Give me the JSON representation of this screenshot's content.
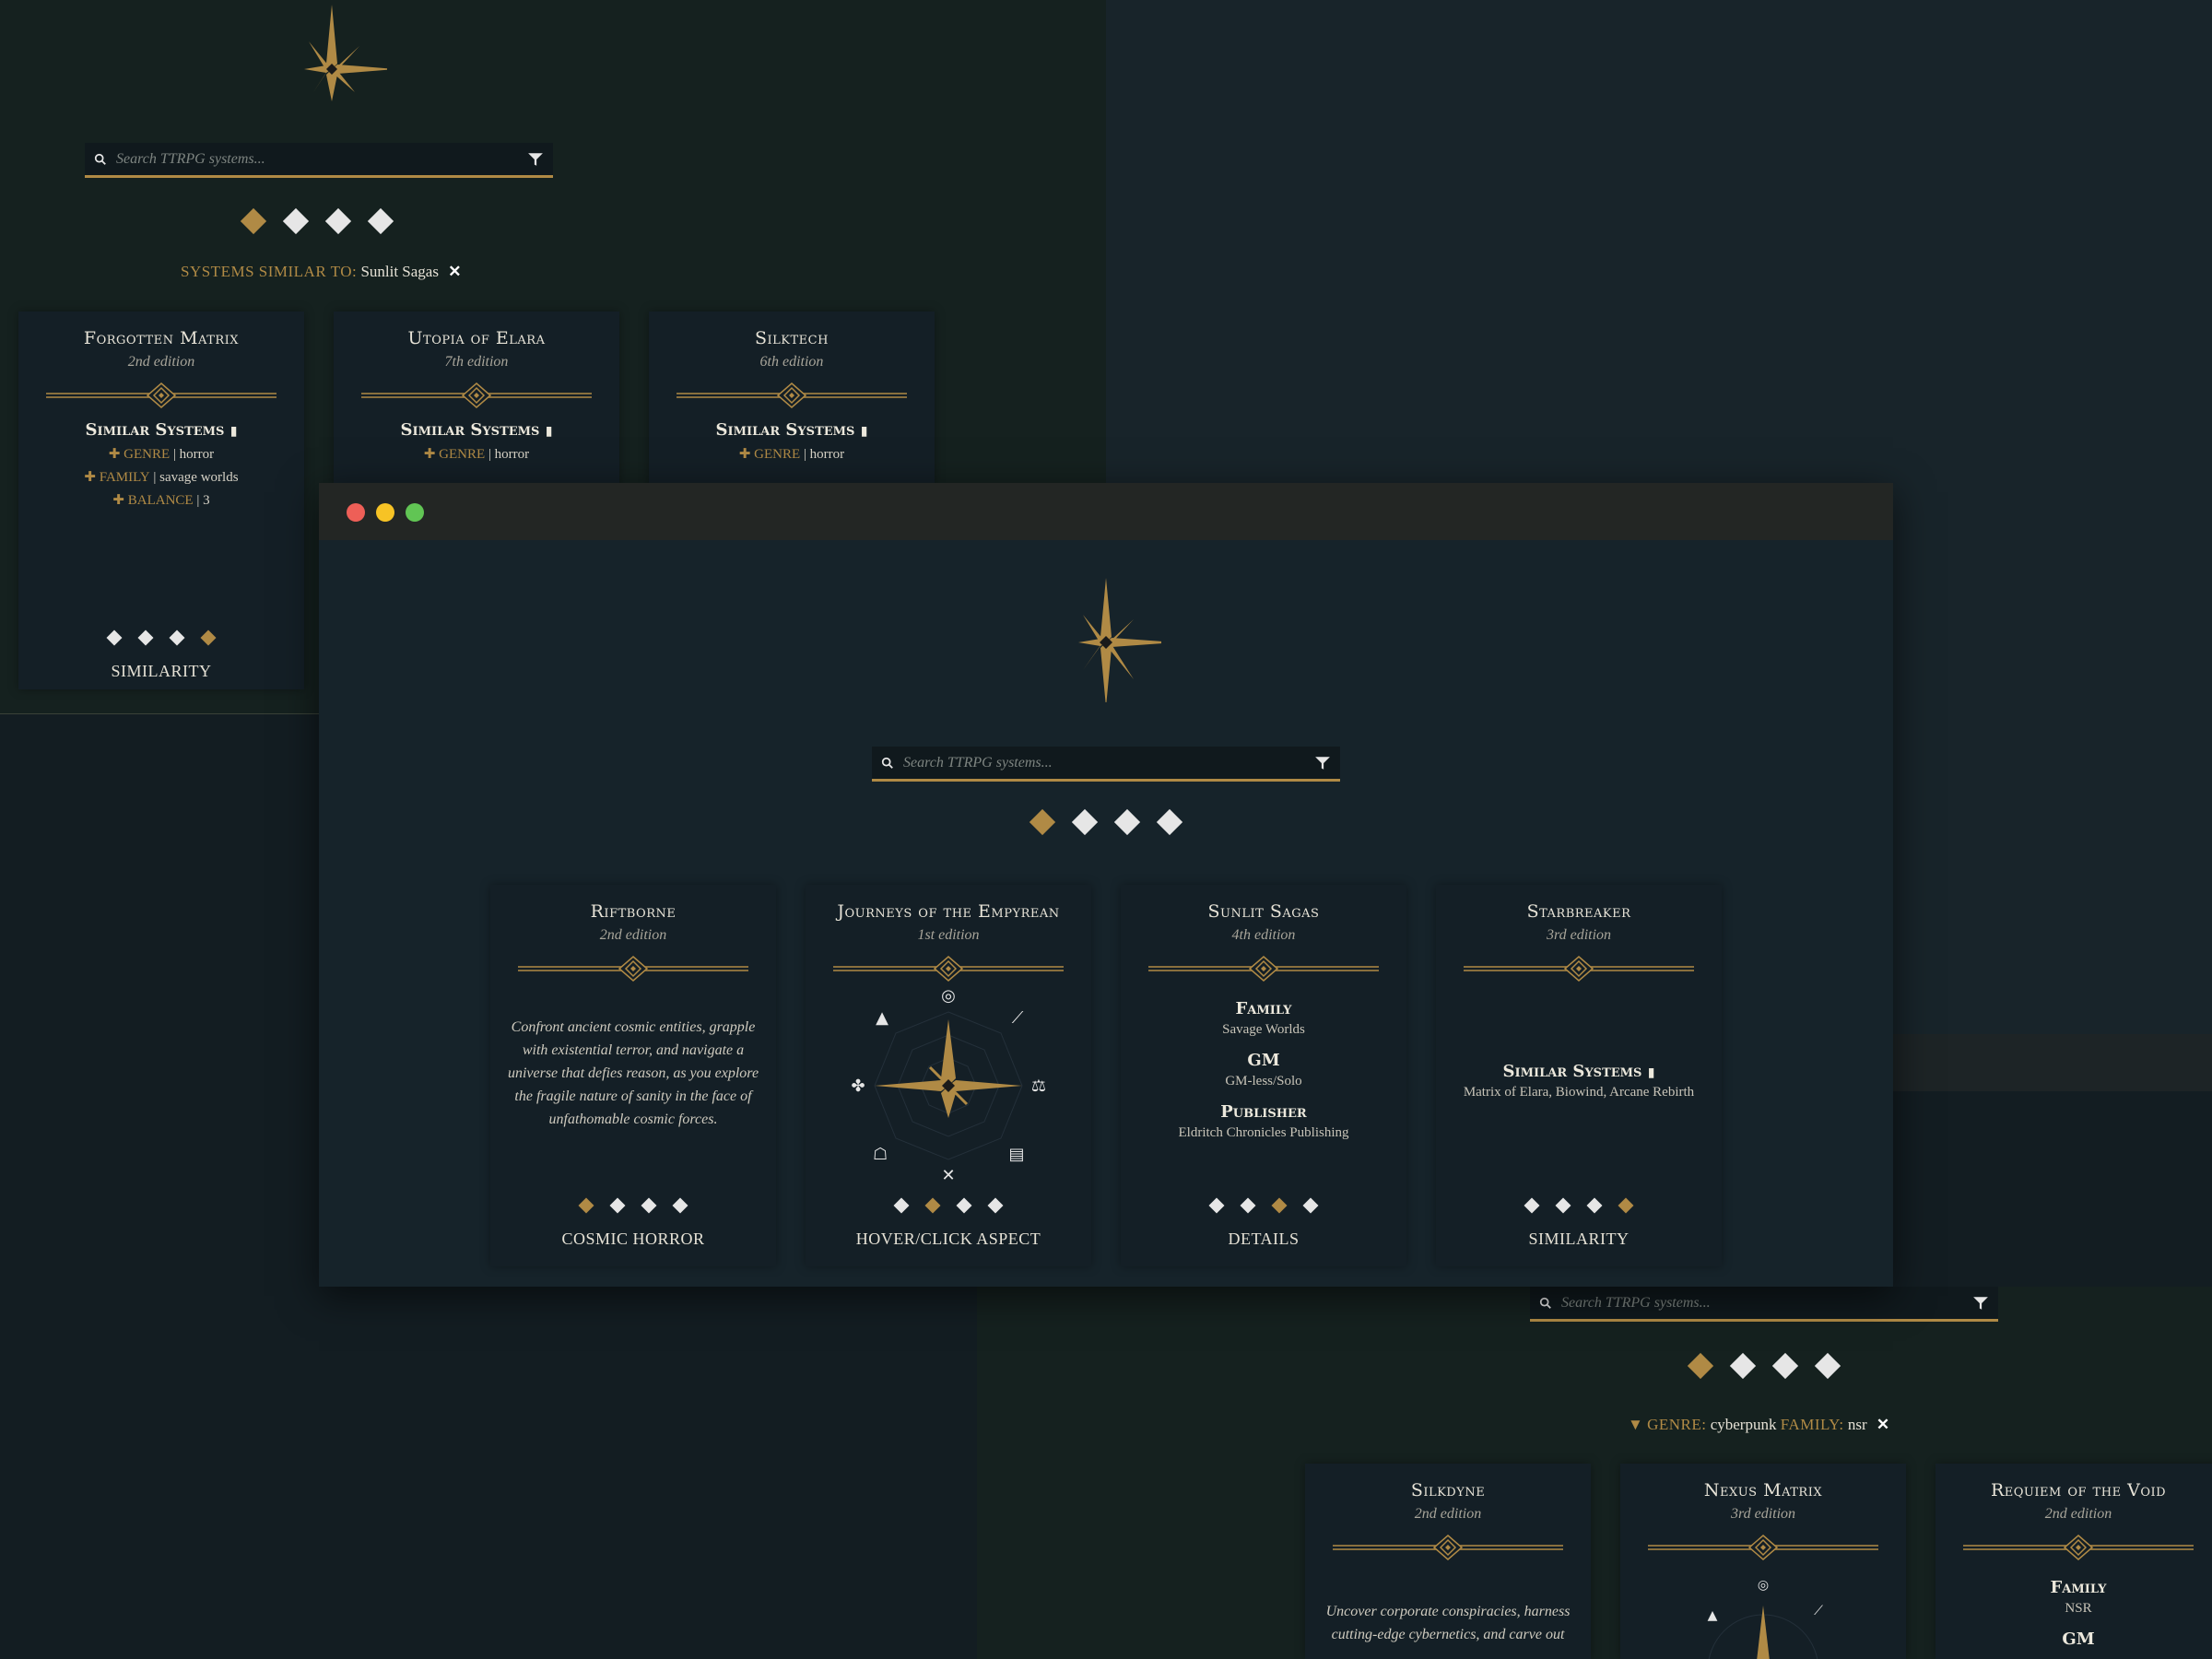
{
  "search": {
    "placeholder": "Search TTRPG systems..."
  },
  "top_panel": {
    "similar_label": "SYSTEMS SIMILAR TO:",
    "similar_value": "Sunlit Sagas",
    "cards": [
      {
        "title": "Forgotten Matrix",
        "edition": "2nd edition",
        "section": "Similar Systems",
        "rows": [
          {
            "k": "GENRE",
            "v": "horror"
          },
          {
            "k": "FAMILY",
            "v": "savage worlds"
          },
          {
            "k": "BALANCE",
            "v": "3"
          }
        ],
        "footer": "SIMILARITY"
      },
      {
        "title": "Utopia of Elara",
        "edition": "7th edition",
        "section": "Similar Systems",
        "rows": [
          {
            "k": "GENRE",
            "v": "horror"
          }
        ]
      },
      {
        "title": "Silktech",
        "edition": "6th edition",
        "section": "Similar Systems",
        "rows": [
          {
            "k": "GENRE",
            "v": "horror"
          }
        ]
      }
    ]
  },
  "main_window": {
    "cards": [
      {
        "title": "Riftborne",
        "edition": "2nd edition",
        "description": "Confront ancient cosmic entities, grapple with existential terror, and navigate a universe that defies reason, as you explore the fragile nature of sanity in the face of unfathomable cosmic forces.",
        "footer": "COSMIC HORROR",
        "active_dot": 0
      },
      {
        "title": "Journeys of the Empyrean",
        "edition": "1st edition",
        "footer": "HOVER/CLICK ASPECT",
        "active_dot": 1,
        "aspect_icons": [
          "brain-icon",
          "stairs-icon",
          "scales-icon",
          "scroll-icon",
          "swords-icon",
          "wizard-icon",
          "puzzle-icon",
          "shapes-icon"
        ]
      },
      {
        "title": "Sunlit Sagas",
        "edition": "4th edition",
        "details": [
          {
            "label": "Family",
            "value": "Savage Worlds"
          },
          {
            "label": "GM",
            "value": "GM-less/Solo"
          },
          {
            "label": "Publisher",
            "value": "Eldritch Chronicles Publishing"
          }
        ],
        "footer": "DETAILS",
        "active_dot": 2
      },
      {
        "title": "Starbreaker",
        "edition": "3rd edition",
        "section": "Similar Systems",
        "similar_list": "Matrix of Elara, Biowind, Arcane Rebirth",
        "footer": "SIMILARITY",
        "active_dot": 3
      }
    ]
  },
  "bottom_panel": {
    "filter": {
      "genre_label": "GENRE:",
      "genre_value": "cyberpunk",
      "family_label": "FAMILY:",
      "family_value": "nsr"
    },
    "cards": [
      {
        "title": "Silkdyne",
        "edition": "2nd edition",
        "description": "Uncover corporate conspiracies, harness cutting-edge cybernetics, and carve out"
      },
      {
        "title": "Nexus Matrix",
        "edition": "3rd edition"
      },
      {
        "title": "Requiem of the Void",
        "edition": "2nd edition",
        "details": [
          {
            "label": "Family",
            "value": "NSR"
          },
          {
            "label": "GM",
            "value": ""
          }
        ]
      }
    ]
  },
  "colors": {
    "gold": "#b08a45",
    "bg": "#131d22",
    "card": "#141f26",
    "titlebar": "#232624"
  }
}
